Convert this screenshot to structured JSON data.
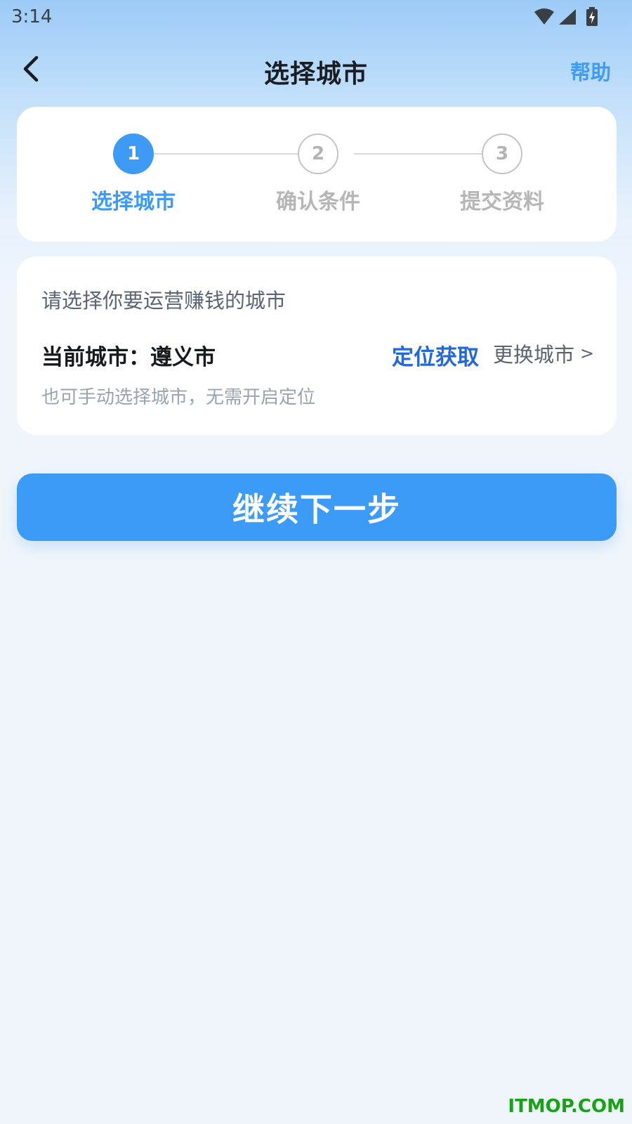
{
  "status_bar": {
    "time": "3:14",
    "icons": [
      "wifi-icon",
      "signal-icon",
      "battery-charging-icon"
    ]
  },
  "nav": {
    "back_icon": "chevron-left-icon",
    "title": "选择城市",
    "help_label": "帮助"
  },
  "steps": [
    {
      "number": "1",
      "label": "选择城市",
      "state": "active"
    },
    {
      "number": "2",
      "label": "确认条件",
      "state": "inactive"
    },
    {
      "number": "3",
      "label": "提交资料",
      "state": "inactive"
    }
  ],
  "city_card": {
    "prompt": "请选择你要运营赚钱的城市",
    "current_city": "当前城市：遵义市",
    "locate_label": "定位获取",
    "change_label": "更换城市",
    "change_arrow": ">",
    "hint": "也可手动选择城市，无需开启定位"
  },
  "next_button_label": "继续下一步",
  "watermark": "ITMOP.COM",
  "colors": {
    "accent": "#3d9bf5",
    "locate_link": "#2367d9",
    "watermark": "#16a316"
  }
}
